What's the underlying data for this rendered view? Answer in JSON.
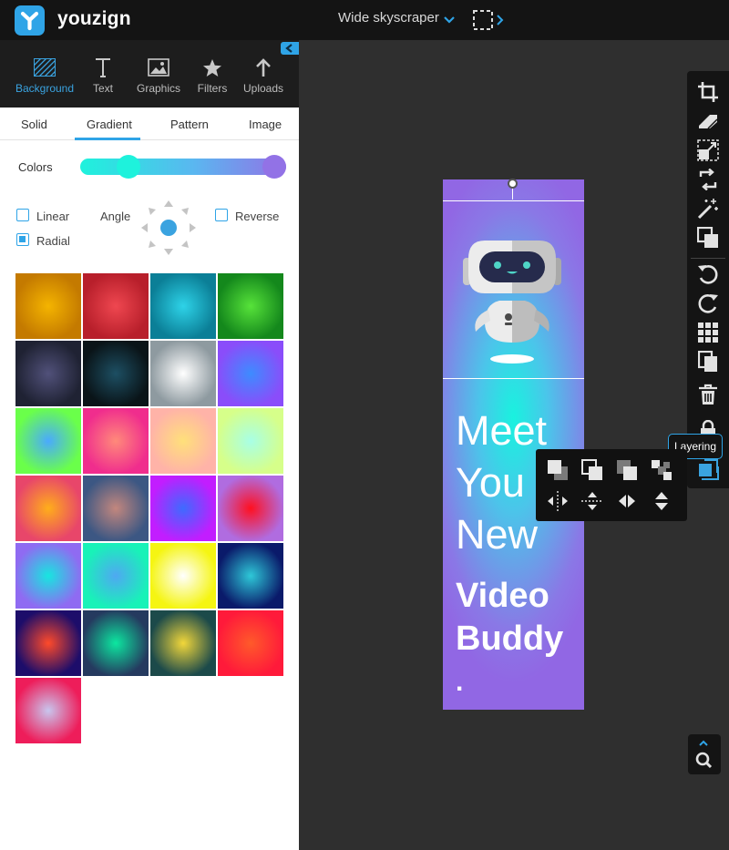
{
  "header": {
    "brand": "youzign",
    "size_select": "Wide skyscraper"
  },
  "tools": [
    {
      "label": "Background",
      "active": true,
      "icon": "background-icon"
    },
    {
      "label": "Text",
      "active": false,
      "icon": "text-icon"
    },
    {
      "label": "Graphics",
      "active": false,
      "icon": "graphics-icon"
    },
    {
      "label": "Filters",
      "active": false,
      "icon": "star-icon"
    },
    {
      "label": "Uploads",
      "active": false,
      "icon": "upload-arrow-icon"
    }
  ],
  "bg_tabs": {
    "solid": "Solid",
    "gradient": "Gradient",
    "pattern": "Pattern",
    "image": "Image",
    "active": "Gradient"
  },
  "gradient_options": {
    "colors_label": "Colors",
    "start_color": "#1ef2dc",
    "end_color": "#9272e6",
    "linear_label": "Linear",
    "linear_checked": false,
    "radial_label": "Radial",
    "radial_checked": true,
    "angle_label": "Angle",
    "reverse_label": "Reverse",
    "reverse_checked": false
  },
  "presets": [
    {
      "inner": "#f4b400",
      "outer": "#c47a00"
    },
    {
      "inner": "#ef4750",
      "outer": "#b81f2b"
    },
    {
      "inner": "#2ed3e8",
      "outer": "#0b7f97"
    },
    {
      "inner": "#57e33a",
      "outer": "#14881c"
    },
    {
      "inner": "#51517a",
      "outer": "#1f2233"
    },
    {
      "inner": "#1d4f63",
      "outer": "#0a1418"
    },
    {
      "inner": "#ffffff",
      "outer": "#8e9aa0"
    },
    {
      "inner": "#3d8cff",
      "outer": "#8a4dfa"
    },
    {
      "inner": "#4aa9ff",
      "outer": "#6aff4a"
    },
    {
      "inner": "#ff8a7a",
      "outer": "#f02d8d"
    },
    {
      "inner": "#ffe07a",
      "outer": "#ffb3a8"
    },
    {
      "inner": "#a8ffe6",
      "outer": "#d6ff8a"
    },
    {
      "inner": "#ffae1a",
      "outer": "#e8466a"
    },
    {
      "inner": "#c3877e",
      "outer": "#3c5783"
    },
    {
      "inner": "#3d6bff",
      "outer": "#c21dff"
    },
    {
      "inner": "#ff1020",
      "outer": "#b06ce0"
    },
    {
      "inner": "#17e6e0",
      "outer": "#8f6bf2"
    },
    {
      "inner": "#4fa8f2",
      "outer": "#18f2b8"
    },
    {
      "inner": "#ffffff",
      "outer": "#f5f512"
    },
    {
      "inner": "#2ec8d8",
      "outer": "#0a1a6a"
    },
    {
      "inner": "#ff4a2a",
      "outer": "#1d0d6a"
    },
    {
      "inner": "#0ce7a0",
      "outer": "#253a5f"
    },
    {
      "inner": "#f2d73a",
      "outer": "#1c4a4a"
    },
    {
      "inner": "#ff5a2a",
      "outer": "#ff1a3a"
    },
    {
      "inner": "#c8c6ee",
      "outer": "#ee1d5a"
    }
  ],
  "design": {
    "headline": [
      "Meet",
      "You",
      "New"
    ],
    "subline": [
      "Video",
      "Buddy"
    ],
    "dot": "."
  },
  "right_tools": [
    "crop-icon",
    "eraser-icon",
    "resize-icon",
    "flip-icon",
    "magic-wand-icon",
    "duplicate-layer-icon",
    "undo-icon",
    "redo-icon",
    "grid-icon",
    "copy-icon",
    "trash-icon",
    "lock-icon",
    "layering-icon"
  ],
  "tooltip": "Layering",
  "layering_menu": [
    "bring-to-front-icon",
    "bring-forward-icon",
    "send-backward-icon",
    "send-to-back-icon",
    "align-center-vertical-icon",
    "align-center-horizontal-icon",
    "flip-horizontal-icon",
    "flip-vertical-icon"
  ]
}
